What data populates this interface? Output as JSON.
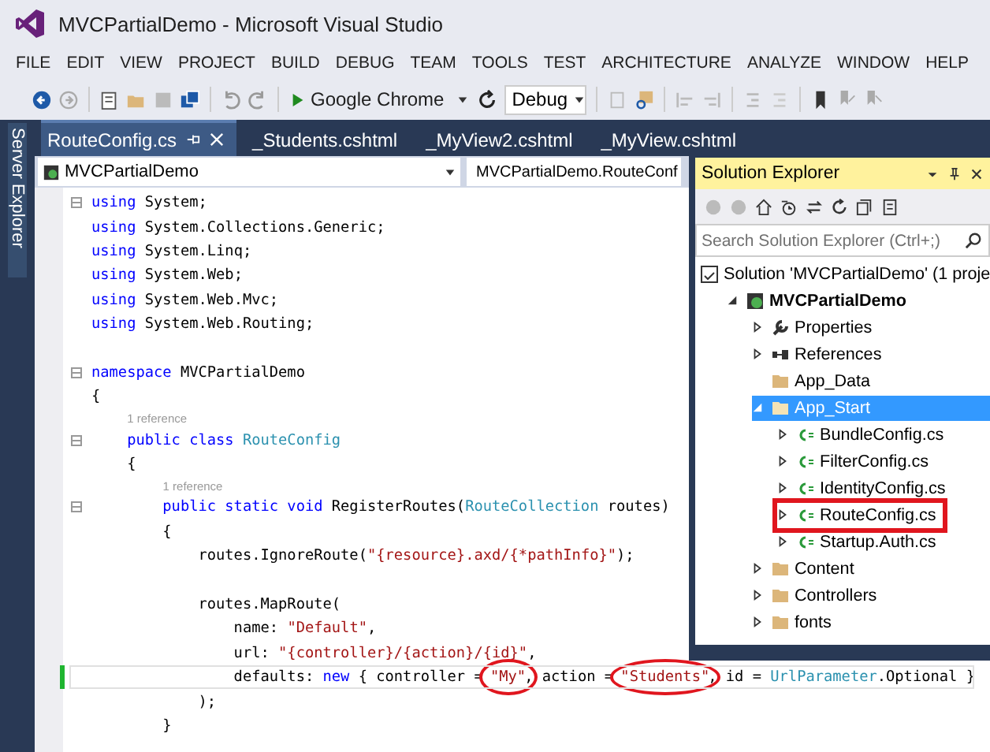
{
  "window": {
    "title": "MVCPartialDemo - Microsoft Visual Studio"
  },
  "menu": [
    "FILE",
    "EDIT",
    "VIEW",
    "PROJECT",
    "BUILD",
    "DEBUG",
    "TEAM",
    "TOOLS",
    "TEST",
    "ARCHITECTURE",
    "ANALYZE",
    "WINDOW",
    "HELP"
  ],
  "toolbar": {
    "run_target": "Google Chrome",
    "configuration": "Debug"
  },
  "side_tab": "Server Explorer",
  "tabs": [
    {
      "label": "RouteConfig.cs",
      "selected": true
    },
    {
      "label": "_Students.cshtml",
      "selected": false
    },
    {
      "label": "_MyView2.cshtml",
      "selected": false
    },
    {
      "label": "_MyView.cshtml",
      "selected": false
    }
  ],
  "navigation": {
    "project": "MVCPartialDemo",
    "type": "MVCPartialDemo.RouteConf"
  },
  "code": [
    {
      "kind": "code",
      "fold": true,
      "tokens": [
        {
          "kind": "kw",
          "text": "using"
        },
        {
          "kind": "plain",
          "text": " System;"
        }
      ]
    },
    {
      "kind": "code",
      "tokens": [
        {
          "kind": "kw",
          "text": "using"
        },
        {
          "kind": "plain",
          "text": " System.Collections.Generic;"
        }
      ]
    },
    {
      "kind": "code",
      "tokens": [
        {
          "kind": "kw",
          "text": "using"
        },
        {
          "kind": "plain",
          "text": " System.Linq;"
        }
      ]
    },
    {
      "kind": "code",
      "tokens": [
        {
          "kind": "kw",
          "text": "using"
        },
        {
          "kind": "plain",
          "text": " System.Web;"
        }
      ]
    },
    {
      "kind": "code",
      "tokens": [
        {
          "kind": "kw",
          "text": "using"
        },
        {
          "kind": "plain",
          "text": " System.Web.Mvc;"
        }
      ]
    },
    {
      "kind": "code",
      "tokens": [
        {
          "kind": "kw",
          "text": "using"
        },
        {
          "kind": "plain",
          "text": " System.Web.Routing;"
        }
      ]
    },
    {
      "kind": "blank"
    },
    {
      "kind": "code",
      "fold": true,
      "tokens": [
        {
          "kind": "kw",
          "text": "namespace"
        },
        {
          "kind": "plain",
          "text": " MVCPartialDemo"
        }
      ]
    },
    {
      "kind": "code",
      "tokens": [
        {
          "kind": "plain",
          "text": "{"
        }
      ]
    },
    {
      "kind": "code",
      "fold": true,
      "lens": "1 reference",
      "tokens": [
        {
          "kind": "kw",
          "text": "    public class "
        },
        {
          "kind": "type",
          "text": "RouteConfig"
        }
      ]
    },
    {
      "kind": "code",
      "tokens": [
        {
          "kind": "plain",
          "text": "    {"
        }
      ]
    },
    {
      "kind": "code",
      "fold": true,
      "lens": "1 reference",
      "tokens": [
        {
          "kind": "kw",
          "text": "        public static void"
        },
        {
          "kind": "plain",
          "text": " RegisterRoutes("
        },
        {
          "kind": "type",
          "text": "RouteCollection"
        },
        {
          "kind": "plain",
          "text": " routes)"
        }
      ]
    },
    {
      "kind": "code",
      "tokens": [
        {
          "kind": "plain",
          "text": "        {"
        }
      ]
    },
    {
      "kind": "code",
      "tokens": [
        {
          "kind": "plain",
          "text": "            routes.IgnoreRoute("
        },
        {
          "kind": "str",
          "text": "\"{resource}.axd/{*pathInfo}\""
        },
        {
          "kind": "plain",
          "text": ");"
        }
      ]
    },
    {
      "kind": "blank"
    },
    {
      "kind": "code",
      "tokens": [
        {
          "kind": "plain",
          "text": "            routes.MapRoute("
        }
      ]
    },
    {
      "kind": "code",
      "tokens": [
        {
          "kind": "plain",
          "text": "                name: "
        },
        {
          "kind": "str",
          "text": "\"Default\""
        },
        {
          "kind": "plain",
          "text": ","
        }
      ]
    },
    {
      "kind": "code",
      "tokens": [
        {
          "kind": "plain",
          "text": "                url: "
        },
        {
          "kind": "str",
          "text": "\"{controller}/{action}/{id}\""
        },
        {
          "kind": "plain",
          "text": ","
        }
      ]
    },
    {
      "kind": "code",
      "changed": true,
      "current": true,
      "tokens": [
        {
          "kind": "plain",
          "text": "                defaults: "
        },
        {
          "kind": "kw",
          "text": "new"
        },
        {
          "kind": "plain",
          "text": " { controller = "
        },
        {
          "kind": "str",
          "text": "\"My\"",
          "circled": true
        },
        {
          "kind": "plain",
          "text": ", action = "
        },
        {
          "kind": "str",
          "text": "\"Students\"",
          "circled": true
        },
        {
          "kind": "plain",
          "text": ", id = "
        },
        {
          "kind": "type",
          "text": "UrlParameter"
        },
        {
          "kind": "plain",
          "text": ".Optional }"
        }
      ]
    },
    {
      "kind": "code",
      "tokens": [
        {
          "kind": "plain",
          "text": "            );"
        }
      ]
    },
    {
      "kind": "code",
      "tokens": [
        {
          "kind": "plain",
          "text": "        }"
        }
      ]
    }
  ],
  "solution_explorer": {
    "title": "Solution Explorer",
    "search": {
      "placeholder": "Search Solution Explorer (Ctrl+;)"
    },
    "tree": [
      {
        "kind": "solution",
        "label": "Solution 'MVCPartialDemo' (1 proje",
        "selected": false,
        "children": [
          {
            "kind": "project",
            "label": "MVCPartialDemo",
            "expanded": true,
            "selected": false,
            "children": [
              {
                "kind": "properties",
                "label": "Properties",
                "expanded": false,
                "selected": false
              },
              {
                "kind": "references",
                "label": "References",
                "expanded": false,
                "selected": false
              },
              {
                "kind": "folder",
                "label": "App_Data",
                "selected": false
              },
              {
                "kind": "folder",
                "label": "App_Start",
                "expanded": true,
                "selected": true,
                "children": [
                  {
                    "kind": "csharp",
                    "label": "BundleConfig.cs",
                    "expanded": false,
                    "selected": false
                  },
                  {
                    "kind": "csharp",
                    "label": "FilterConfig.cs",
                    "expanded": false,
                    "selected": false
                  },
                  {
                    "kind": "csharp",
                    "label": "IdentityConfig.cs",
                    "expanded": false,
                    "selected": false
                  },
                  {
                    "kind": "csharp",
                    "label": "RouteConfig.cs",
                    "expanded": false,
                    "selected": false,
                    "highlighted": true
                  },
                  {
                    "kind": "csharp",
                    "label": "Startup.Auth.cs",
                    "expanded": false,
                    "selected": false
                  }
                ]
              },
              {
                "kind": "folder",
                "label": "Content",
                "expanded": false,
                "selected": false
              },
              {
                "kind": "folder",
                "label": "Controllers",
                "expanded": false,
                "selected": false
              },
              {
                "kind": "folder",
                "label": "fonts",
                "expanded": false,
                "selected": false
              }
            ]
          }
        ]
      }
    ]
  }
}
